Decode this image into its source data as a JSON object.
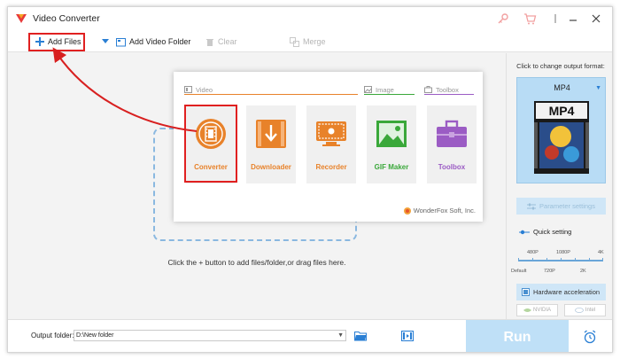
{
  "window": {
    "title": "Video Converter",
    "icons": [
      "app-logo-icon",
      "key-icon",
      "cart-icon",
      "menu-icon",
      "minimize-icon",
      "close-icon"
    ]
  },
  "toolbar": {
    "add_files": "Add Files",
    "add_video_folder": "Add Video Folder",
    "clear": "Clear",
    "merge": "Merge"
  },
  "popup": {
    "categories": {
      "video": "Video",
      "image": "Image",
      "toolbox": "Toolbox"
    },
    "tiles": [
      {
        "label": "Converter",
        "color": "#e8822a",
        "icon": "film-icon"
      },
      {
        "label": "Downloader",
        "color": "#e8822a",
        "icon": "download-icon"
      },
      {
        "label": "Recorder",
        "color": "#e8822a",
        "icon": "screen-record-icon"
      },
      {
        "label": "GIF Maker",
        "color": "#3aa83a",
        "icon": "image-icon"
      },
      {
        "label": "Toolbox",
        "color": "#9b5cc4",
        "icon": "toolbox-icon"
      }
    ],
    "brand": "WonderFox Soft, Inc."
  },
  "main": {
    "hint": "Click the + button to add files/folder,or drag files here."
  },
  "right_panel": {
    "title": "Click to change output format:",
    "format": "MP4",
    "format_image_label": "MP4",
    "parameter_settings": "Parameter settings",
    "quick_setting": "Quick setting",
    "slider_top_labels": [
      "480P",
      "1080P",
      "4K"
    ],
    "slider_bottom_labels": [
      "Default",
      "720P",
      "2K"
    ],
    "hardware_acceleration": "Hardware acceleration",
    "nvidia": "NVIDIA",
    "intel": "Intel"
  },
  "bottom": {
    "output_folder_label": "Output folder:",
    "output_folder_value": "D:\\New folder",
    "run": "Run"
  },
  "colors": {
    "highlight": "#e02020",
    "accent": "#2a7fd4",
    "converter_orange": "#e8822a"
  }
}
